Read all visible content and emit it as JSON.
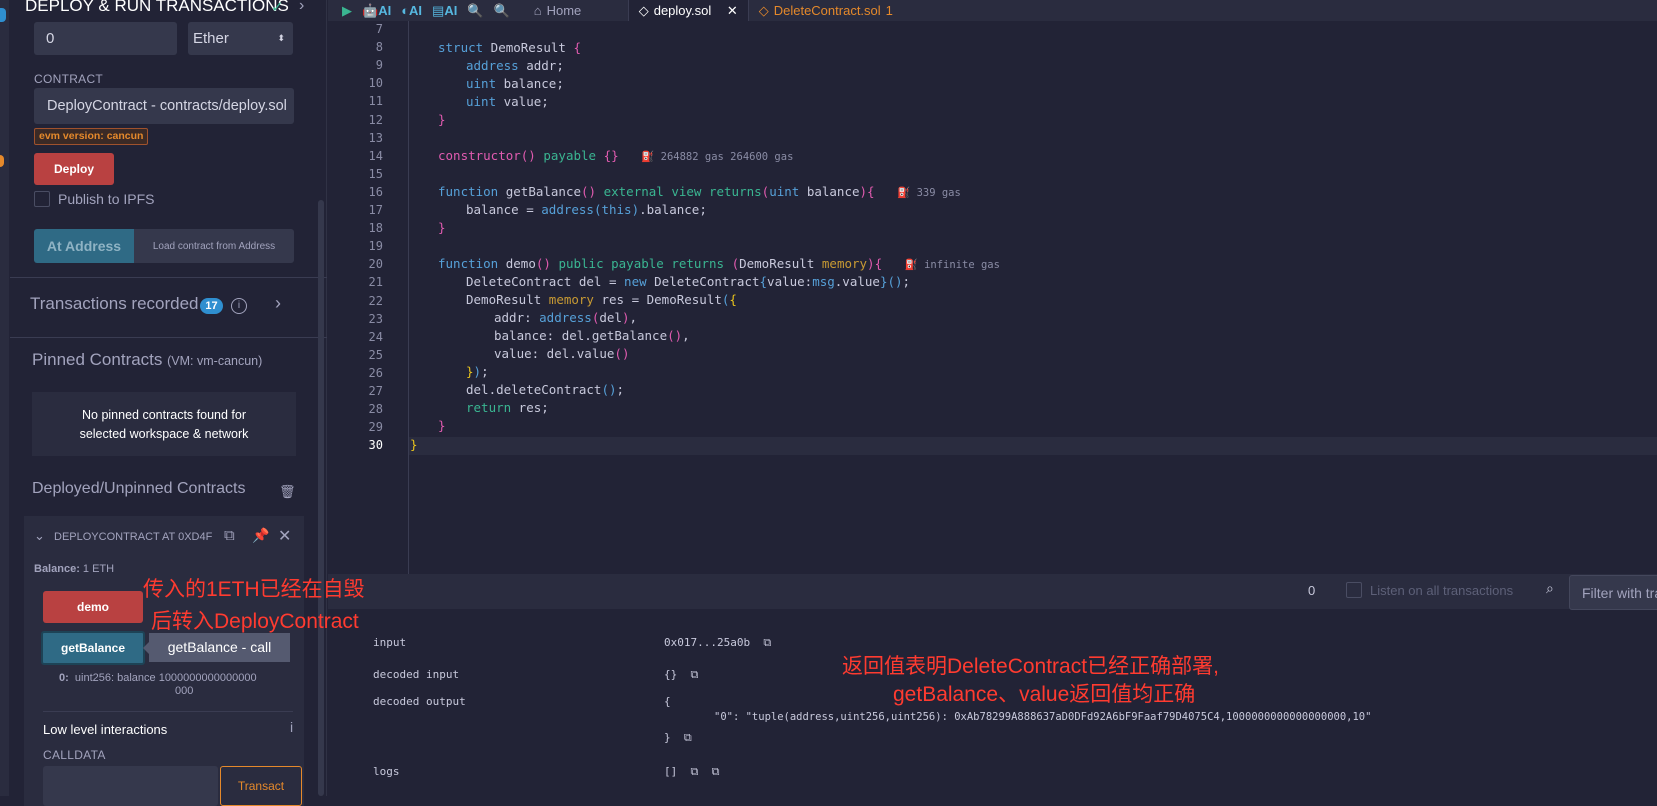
{
  "panel": {
    "title": "DEPLOY & RUN TRANSACTIONS",
    "value_input": "0",
    "unit_select": "Ether",
    "contract_label": "CONTRACT",
    "contract_select": "DeployContract - contracts/deploy.sol",
    "evm_badge": "evm version: cancun",
    "deploy_label": "Deploy",
    "publish_label": "Publish to IPFS",
    "at_address_label": "At Address",
    "at_address_placeholder": "Load contract from Address",
    "transactions_recorded": "Transactions recorded",
    "transactions_count": "17",
    "pinned_title": "Pinned Contracts",
    "pinned_network": "(VM: vm-cancun)",
    "no_pinned_line1": "No pinned contracts found for",
    "no_pinned_line2": "selected workspace & network",
    "deployed_title": "Deployed/Unpinned Contracts",
    "instance": {
      "title": "DEPLOYCONTRACT AT 0XD4F",
      "balance_label": "Balance:",
      "balance_value": "1 ETH",
      "demo_label": "demo",
      "getbalance_label": "getBalance",
      "tooltip": "getBalance - call",
      "output_index": "0:",
      "output_line1": "uint256: balance 1000000000000000",
      "output_line2": "000"
    },
    "low_level_title": "Low level interactions",
    "calldata_label": "CALLDATA",
    "transact_label": "Transact"
  },
  "toolbar": {
    "ai1": "AI",
    "ai2": "AI",
    "ai3": "AI"
  },
  "tabs": [
    {
      "label": "Home"
    },
    {
      "label": "deploy.sol"
    },
    {
      "label": "DeleteContract.sol",
      "badge": "1"
    }
  ],
  "code": {
    "line_numbers": [
      "7",
      "8",
      "9",
      "10",
      "11",
      "12",
      "13",
      "14",
      "15",
      "16",
      "17",
      "18",
      "19",
      "20",
      "21",
      "22",
      "23",
      "24",
      "25",
      "26",
      "27",
      "28",
      "29",
      "30"
    ],
    "gas_constructor": "264882 gas 264600 gas",
    "gas_getbalance": "339 gas",
    "gas_demo": "infinite gas"
  },
  "terminal": {
    "count": "0",
    "listen_label": "Listen on all transactions",
    "filter_placeholder": "Filter with transaction hash or address",
    "rows": [
      {
        "label": "input",
        "value": "0x017...25a0b"
      },
      {
        "label": "decoded input",
        "value": "{}"
      },
      {
        "label": "decoded output",
        "value": "{"
      },
      {
        "label": "",
        "value": "\"0\": \"tuple(address,uint256,uint256): 0xAb78299A888637aD0DFd92A6bF9Faaf79D4075C4,1000000000000000000,10\""
      },
      {
        "label": "",
        "value": "}"
      },
      {
        "label": "logs",
        "value": "[]"
      }
    ]
  },
  "annotations": {
    "left_line1": "传入的1ETH已经在自毁",
    "left_line2": "后转入DeployContract",
    "right_line1": "返回值表明DeleteContract已经正确部署,",
    "right_line2": "getBalance、value返回值均正确"
  },
  "colors": {
    "deploy": "#b94141",
    "at_address": "#2f6a85",
    "annotation": "#ff3b30",
    "accent_orange": "#e5892b"
  }
}
